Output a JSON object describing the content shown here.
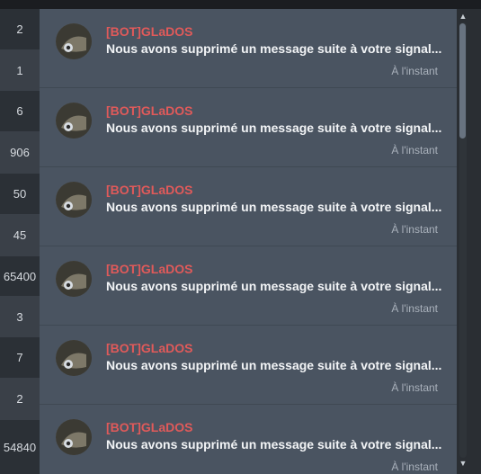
{
  "left_counts": [
    "2",
    "1",
    "6",
    "906",
    "50",
    "45",
    "65400",
    "3",
    "7",
    "2",
    "54840"
  ],
  "notifications": [
    {
      "author": "[BOT]GLaDOS",
      "message": "Nous avons supprimé un message suite à votre signal...",
      "time": "À l'instant"
    },
    {
      "author": "[BOT]GLaDOS",
      "message": "Nous avons supprimé un message suite à votre signal...",
      "time": "À l'instant"
    },
    {
      "author": "[BOT]GLaDOS",
      "message": "Nous avons supprimé un message suite à votre signal...",
      "time": "À l'instant"
    },
    {
      "author": "[BOT]GLaDOS",
      "message": "Nous avons supprimé un message suite à votre signal...",
      "time": "À l'instant"
    },
    {
      "author": "[BOT]GLaDOS",
      "message": "Nous avons supprimé un message suite à votre signal...",
      "time": "À l'instant"
    },
    {
      "author": "[BOT]GLaDOS",
      "message": "Nous avons supprimé un message suite à votre signal...",
      "time": "À l'instant"
    }
  ],
  "icons": {
    "scroll_up": "chevron-up-icon",
    "scroll_down": "chevron-down-icon",
    "avatar": "glados-avatar-icon"
  },
  "colors": {
    "author": "#e05a5a",
    "panel": "#4a5461",
    "message": "#f2f4f6"
  }
}
